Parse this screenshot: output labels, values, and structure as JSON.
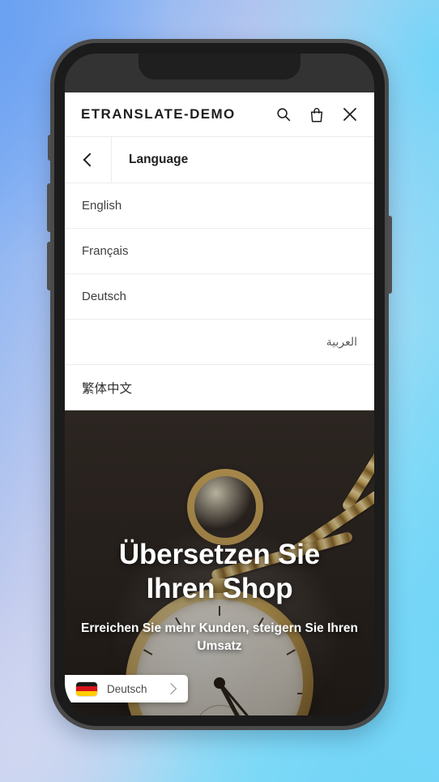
{
  "background": {
    "gradient_from": "#74a8f0",
    "gradient_mid": "#c9d3f0",
    "gradient_to": "#6fd2f6"
  },
  "device": {
    "frame_color": "#4a4a4a",
    "bezel_color": "#1b1b1b",
    "status_bar_color": "#333333",
    "buttons": [
      {
        "name": "silent-switch"
      },
      {
        "name": "volume-up-button"
      },
      {
        "name": "volume-down-button"
      },
      {
        "name": "power-button"
      }
    ]
  },
  "header": {
    "brand": "ETRANSLATE-DEMO",
    "icons": [
      {
        "name": "search-icon",
        "label": "Search"
      },
      {
        "name": "shopping-bag-icon",
        "label": "Cart"
      },
      {
        "name": "close-icon",
        "label": "Close"
      }
    ]
  },
  "menu": {
    "back_label": "Back",
    "title": "Language",
    "items": [
      {
        "label": "English"
      },
      {
        "label": "Français"
      },
      {
        "label": "Deutsch"
      },
      {
        "label": "العربية"
      },
      {
        "label": "繁体中文"
      }
    ]
  },
  "hero": {
    "title_line1": "Übersetzen Sie",
    "title_line2": "Ihren Shop",
    "subtitle": "Erreichen Sie mehr Kunden, steigern Sie Ihren Umsatz",
    "background_color": "#332c27"
  },
  "language_switcher": {
    "flag": "german-flag",
    "label": "Deutsch",
    "chevron": "chevron-right-icon",
    "flag_colors": {
      "black": "#1a1a1a",
      "red": "#d7141a",
      "gold": "#ffce00"
    }
  }
}
